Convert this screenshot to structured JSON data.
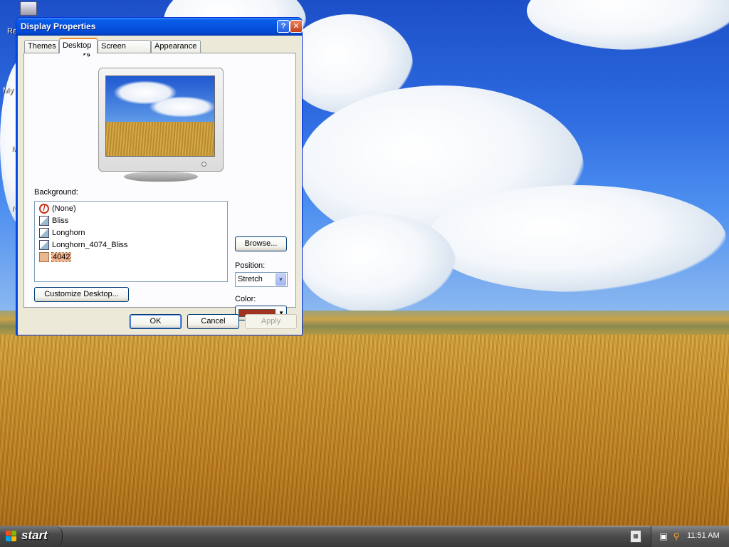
{
  "desktop": {
    "icon_labels": [
      "Re",
      "My",
      "M",
      "N"
    ]
  },
  "window": {
    "title": "Display Properties",
    "help_label": "?",
    "close_label": "✕",
    "tabs": [
      {
        "label": "Themes",
        "active": false
      },
      {
        "label": "Desktop",
        "active": true
      },
      {
        "label": "Screen Saver",
        "active": false
      },
      {
        "label": "Appearance",
        "active": false
      }
    ],
    "background_label": "Background:",
    "backgrounds": [
      {
        "label": "(None)",
        "icon": "none-icon",
        "selected": false
      },
      {
        "label": "Bliss",
        "icon": "image-file-icon",
        "selected": false
      },
      {
        "label": "Longhorn",
        "icon": "image-file-icon",
        "selected": false
      },
      {
        "label": "Longhorn_4074_Bliss",
        "icon": "image-file-icon",
        "selected": false
      },
      {
        "label": "4042",
        "icon": "image-file-icon",
        "selected": true
      }
    ],
    "browse_label": "Browse...",
    "position_label": "Position:",
    "position_value": "Stretch",
    "color_label": "Color:",
    "color_value": "#a0321e",
    "customize_label": "Customize Desktop...",
    "ok_label": "OK",
    "cancel_label": "Cancel",
    "apply_label": "Apply"
  },
  "taskbar": {
    "start_label": "start",
    "clock": "11:51 AM",
    "keyboard_icon_label": "▦"
  }
}
